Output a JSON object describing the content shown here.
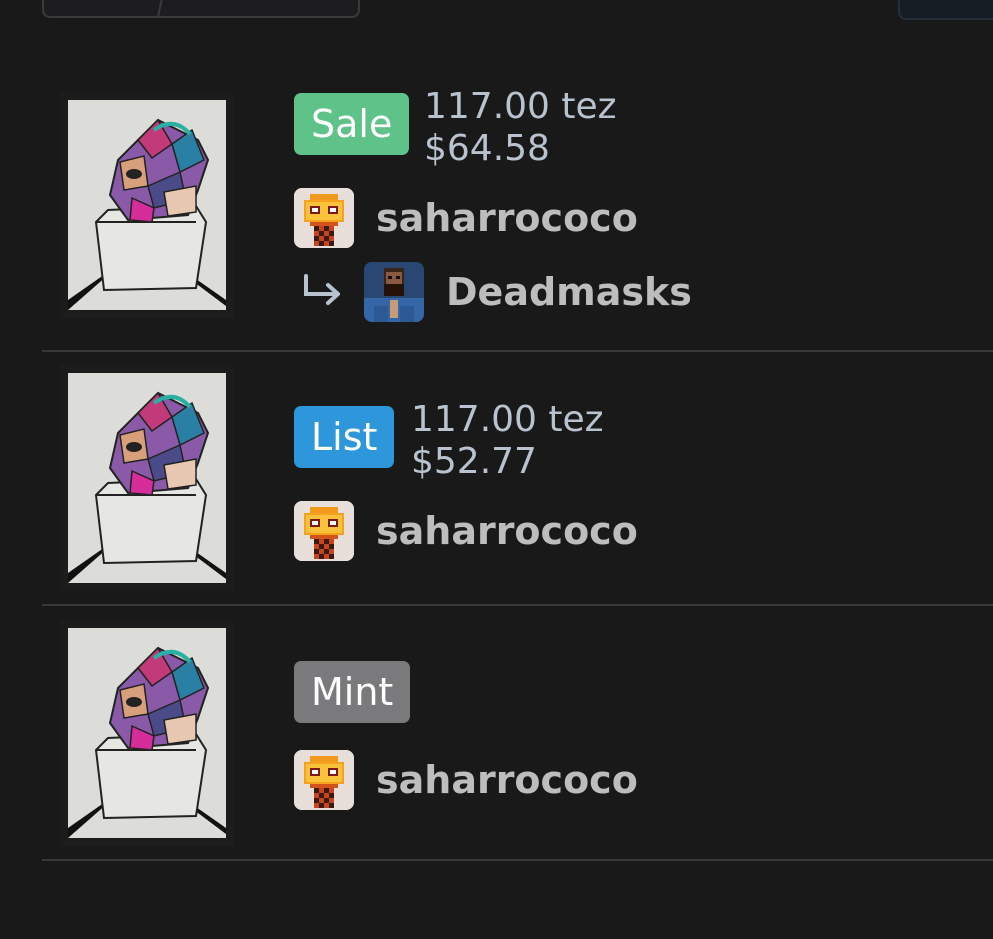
{
  "events": [
    {
      "type_label": "Sale",
      "price_tez": "117.00 tez",
      "price_usd": "$64.58",
      "user": "saharrococo",
      "recipient": "Deadmasks"
    },
    {
      "type_label": "List",
      "price_tez": "117.00 tez",
      "price_usd": "$52.77",
      "user": "saharrococo"
    },
    {
      "type_label": "Mint",
      "user": "saharrococo"
    }
  ],
  "colors": {
    "sale": "#5fc389",
    "list": "#2e96db",
    "mint": "#7a7a7c"
  },
  "icons": {
    "recipient_arrow": "arrow-down-right-icon",
    "artwork": "artwork-thumbnail",
    "user_avatar": "pixel-avatar-icon"
  }
}
